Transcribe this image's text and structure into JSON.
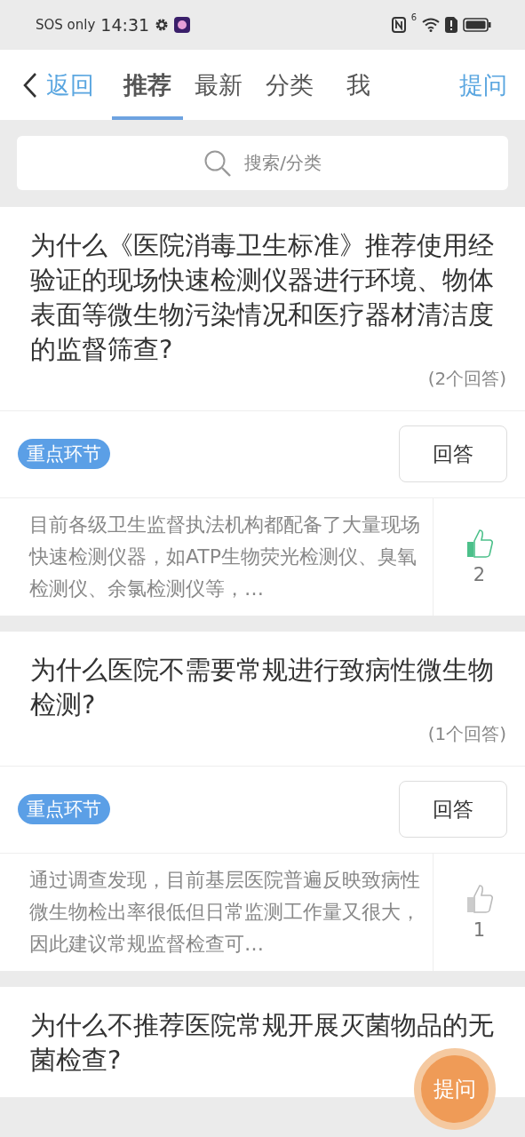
{
  "status_bar": {
    "carrier": "SOS only",
    "time": "14:31",
    "network": "6"
  },
  "nav": {
    "back": "返回",
    "tabs": [
      {
        "label": "推荐",
        "selected": true
      },
      {
        "label": "最新",
        "selected": false
      },
      {
        "label": "分类",
        "selected": false
      },
      {
        "label": "我",
        "selected": false
      }
    ],
    "ask": "提问"
  },
  "search": {
    "placeholder": "搜索/分类"
  },
  "questions": [
    {
      "title": "为什么《医院消毒卫生标准》推荐使用经验证的现场快速检测仪器进行环境、物体表面等微生物污染情况和医疗器材清洁度的监督筛查?",
      "count": "(2个回答)",
      "tag": "重点环节",
      "answer_button": "回答",
      "answer": "目前各级卫生监督执法机构都配备了大量现场快速检测仪器，如ATP生物荧光检测仪、臭氧检测仪、余氯检测仪等，…",
      "likes": "2",
      "liked": true
    },
    {
      "title": "为什么医院不需要常规进行致病性微生物检测?",
      "count": "(1个回答)",
      "tag": "重点环节",
      "answer_button": "回答",
      "answer": "通过调查发现，目前基层医院普遍反映致病性微生物检出率很低但日常监测工作量又很大，因此建议常规监督检查可…",
      "likes": "1",
      "liked": false
    },
    {
      "title": "为什么不推荐医院常规开展灭菌物品的无菌检查?"
    }
  ],
  "floating_button": "提问"
}
